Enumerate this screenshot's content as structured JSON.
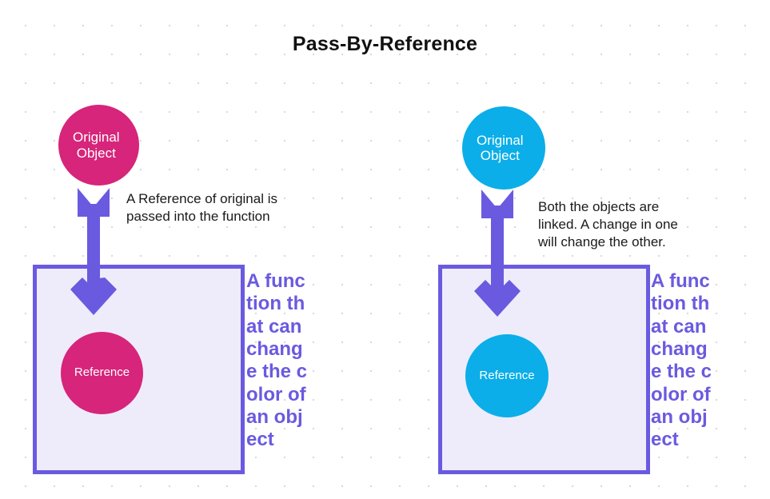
{
  "title": "Pass-By-Reference",
  "theme": {
    "background": "#ffffff",
    "dot_grid": "#d9d9de",
    "purple": "#6a5ae0",
    "box_fill": "#eeecfb",
    "pink": "#d6257a",
    "cyan": "#0baee8",
    "text": "#1a1a1a"
  },
  "left": {
    "original_object_label": "Original\nObject",
    "reference_label": "Reference",
    "annotation": "A Reference of original is\npassed into the function",
    "box_caption": "A function that can change the color of an object",
    "arrow_name": "down-arrow-icon"
  },
  "right": {
    "original_object_label": "Original\nObject",
    "reference_label": "Reference",
    "annotation": "Both the objects are\nlinked. A change in one\nwill change the other.",
    "box_caption": "A function that can change the color of an object",
    "arrow_name": "down-arrow-icon"
  }
}
